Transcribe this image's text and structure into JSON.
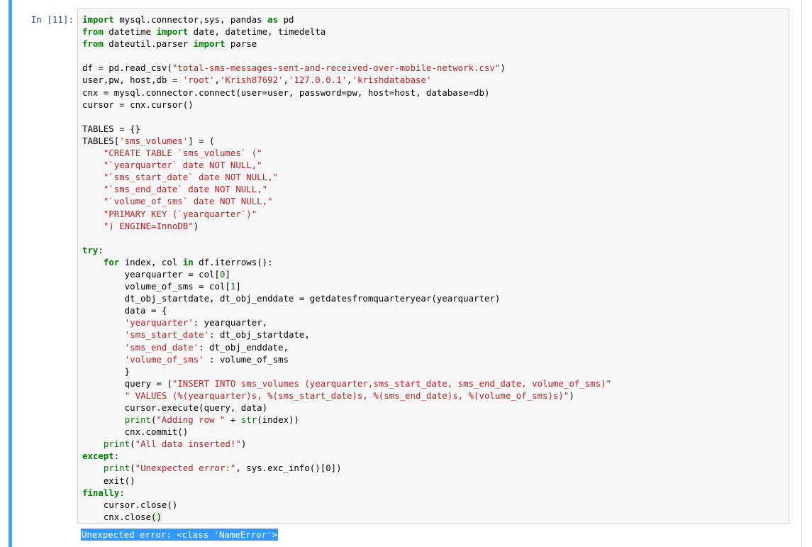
{
  "cell": {
    "prompt": "In [11]:",
    "code_lines": [
      [
        [
          "kw",
          "import"
        ],
        [
          "plain",
          " mysql.connector,sys, pandas "
        ],
        [
          "kw",
          "as"
        ],
        [
          "plain",
          " pd"
        ]
      ],
      [
        [
          "kw",
          "from"
        ],
        [
          "plain",
          " datetime "
        ],
        [
          "kw",
          "import"
        ],
        [
          "plain",
          " date, datetime, timedelta"
        ]
      ],
      [
        [
          "kw",
          "from"
        ],
        [
          "plain",
          " dateutil.parser "
        ],
        [
          "kw",
          "import"
        ],
        [
          "plain",
          " parse"
        ]
      ],
      [
        [
          "plain",
          ""
        ]
      ],
      [
        [
          "plain",
          "df = pd.read_csv("
        ],
        [
          "str",
          "\"total-sms-messages-sent-and-received-over-mobile-network.csv\""
        ],
        [
          "plain",
          ")"
        ]
      ],
      [
        [
          "plain",
          "user,pw, host,db = "
        ],
        [
          "str",
          "'root'"
        ],
        [
          "plain",
          ","
        ],
        [
          "str",
          "'Krish87692'"
        ],
        [
          "plain",
          ","
        ],
        [
          "str",
          "'127.0.0.1'"
        ],
        [
          "plain",
          ","
        ],
        [
          "str",
          "'krishdatabase'"
        ]
      ],
      [
        [
          "plain",
          "cnx = mysql.connector.connect(user=user, password=pw, host=host, database=db)"
        ]
      ],
      [
        [
          "plain",
          "cursor = cnx.cursor()"
        ]
      ],
      [
        [
          "plain",
          ""
        ]
      ],
      [
        [
          "plain",
          "TABLES = {}"
        ]
      ],
      [
        [
          "plain",
          "TABLES["
        ],
        [
          "str",
          "'sms_volumes'"
        ],
        [
          "plain",
          "] = ("
        ]
      ],
      [
        [
          "plain",
          "    "
        ],
        [
          "str",
          "\"CREATE TABLE `sms_volumes` (\""
        ]
      ],
      [
        [
          "plain",
          "    "
        ],
        [
          "str",
          "\"`yearquarter` date NOT NULL,\""
        ]
      ],
      [
        [
          "plain",
          "    "
        ],
        [
          "str",
          "\"`sms_start_date` date NOT NULL,\""
        ]
      ],
      [
        [
          "plain",
          "    "
        ],
        [
          "str",
          "\"`sms_end_date` date NOT NULL,\""
        ]
      ],
      [
        [
          "plain",
          "    "
        ],
        [
          "str",
          "\"`volume_of_sms` date NOT NULL,\""
        ]
      ],
      [
        [
          "plain",
          "    "
        ],
        [
          "str",
          "\"PRIMARY KEY (`yearquarter`)\""
        ]
      ],
      [
        [
          "plain",
          "    "
        ],
        [
          "str",
          "\") ENGINE=InnoDB\""
        ],
        [
          "plain",
          ")"
        ]
      ],
      [
        [
          "plain",
          ""
        ]
      ],
      [
        [
          "kw",
          "try"
        ],
        [
          "plain",
          ":"
        ]
      ],
      [
        [
          "plain",
          "    "
        ],
        [
          "kw",
          "for"
        ],
        [
          "plain",
          " index, col "
        ],
        [
          "kw",
          "in"
        ],
        [
          "plain",
          " df.iterrows():"
        ]
      ],
      [
        [
          "plain",
          "        yearquarter = col["
        ],
        [
          "num",
          "0"
        ],
        [
          "plain",
          "]"
        ]
      ],
      [
        [
          "plain",
          "        volume_of_sms = col["
        ],
        [
          "num",
          "1"
        ],
        [
          "plain",
          "]"
        ]
      ],
      [
        [
          "plain",
          "        dt_obj_startdate, dt_obj_enddate = getdatesfromquarteryear(yearquarter)"
        ]
      ],
      [
        [
          "plain",
          "        data = {"
        ]
      ],
      [
        [
          "plain",
          "        "
        ],
        [
          "str",
          "'yearquarter'"
        ],
        [
          "plain",
          ": yearquarter,"
        ]
      ],
      [
        [
          "plain",
          "        "
        ],
        [
          "str",
          "'sms_start_date'"
        ],
        [
          "plain",
          ": dt_obj_startdate,"
        ]
      ],
      [
        [
          "plain",
          "        "
        ],
        [
          "str",
          "'sms_end_date'"
        ],
        [
          "plain",
          ": dt_obj_enddate,"
        ]
      ],
      [
        [
          "plain",
          "        "
        ],
        [
          "str",
          "'volume_of_sms'"
        ],
        [
          "plain",
          " : volume_of_sms"
        ]
      ],
      [
        [
          "plain",
          "        }"
        ]
      ],
      [
        [
          "plain",
          "        query = ("
        ],
        [
          "str",
          "\"INSERT INTO sms_volumes (yearquarter,sms_start_date, sms_end_date, volume_of_sms)\""
        ]
      ],
      [
        [
          "plain",
          "        "
        ],
        [
          "str",
          "\" VALUES (%(yearquarter)s, %(sms_start_date)s, %(sms_end_date)s, %(volume_of_sms)s)\""
        ],
        [
          "plain",
          ")"
        ]
      ],
      [
        [
          "plain",
          "        cursor.execute(query, data)"
        ]
      ],
      [
        [
          "plain",
          "        "
        ],
        [
          "num",
          "print"
        ],
        [
          "plain",
          "("
        ],
        [
          "str",
          "\"Adding row \""
        ],
        [
          "plain",
          " + "
        ],
        [
          "num",
          "str"
        ],
        [
          "plain",
          "(index))"
        ]
      ],
      [
        [
          "plain",
          "        cnx.commit()"
        ]
      ],
      [
        [
          "plain",
          "    "
        ],
        [
          "num",
          "print"
        ],
        [
          "plain",
          "("
        ],
        [
          "str",
          "\"All data inserted!\""
        ],
        [
          "plain",
          ")"
        ]
      ],
      [
        [
          "kw",
          "except"
        ],
        [
          "plain",
          ":"
        ]
      ],
      [
        [
          "plain",
          "    "
        ],
        [
          "num",
          "print"
        ],
        [
          "plain",
          "("
        ],
        [
          "str",
          "\"Unexpected error:\""
        ],
        [
          "plain",
          ", sys.exc_info()[0])"
        ]
      ],
      [
        [
          "plain",
          "    exit()"
        ]
      ],
      [
        [
          "kw",
          "finally"
        ],
        [
          "plain",
          ":"
        ]
      ],
      [
        [
          "plain",
          "    cursor.close()"
        ]
      ],
      [
        [
          "plain",
          "    cnx.close"
        ],
        [
          "cursor-paren",
          "()"
        ]
      ]
    ]
  },
  "output": {
    "text": "Unexpected error: <class 'NameError'>"
  },
  "colors": {
    "prompt": "#303f9f",
    "keyword": "#008000",
    "string": "#ba2121",
    "selection": "#3399ff",
    "selector_bar": "#42a5f5"
  }
}
